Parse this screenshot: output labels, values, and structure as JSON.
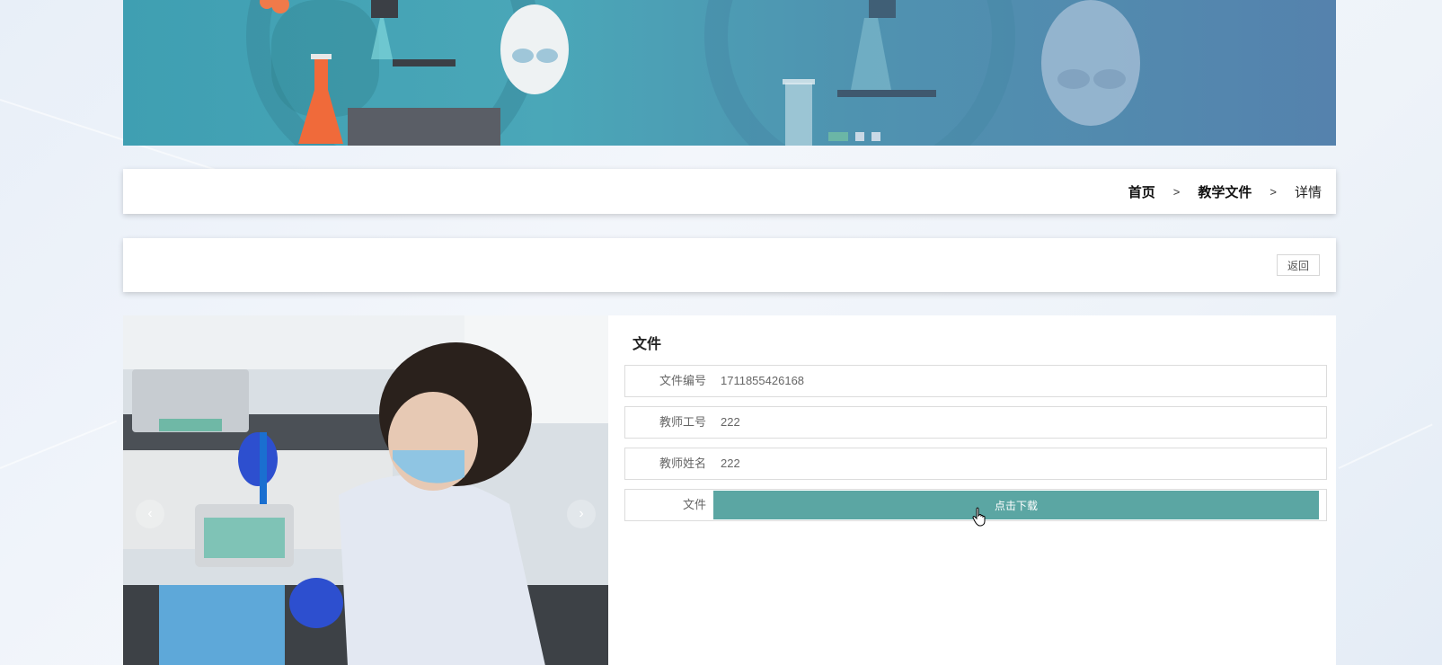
{
  "breadcrumb": {
    "home": "首页",
    "sep1": ">",
    "section": "教学文件",
    "sep2": ">",
    "current": "详情"
  },
  "toolbar": {
    "back_label": "返回"
  },
  "carousel": {
    "prev": "‹",
    "next": "›"
  },
  "detail": {
    "title": "文件",
    "fields": [
      {
        "label": "文件编号",
        "value": "1711855426168"
      },
      {
        "label": "教师工号",
        "value": "222"
      },
      {
        "label": "教师姓名",
        "value": "222"
      }
    ],
    "file_label": "文件",
    "download_label": "点击下载"
  },
  "colors": {
    "accent": "#5ba6a3",
    "banner": "#4aa7b8"
  }
}
